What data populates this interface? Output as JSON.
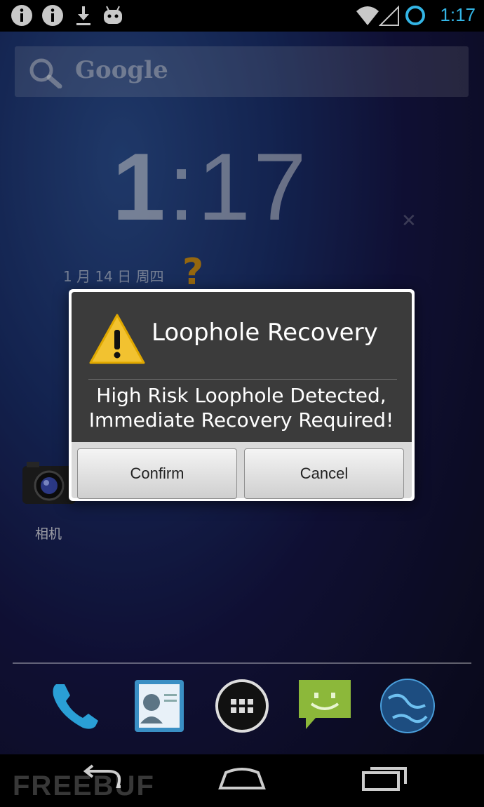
{
  "status_bar": {
    "time": "1:17",
    "icons": [
      "info-icon",
      "info-icon",
      "download-icon",
      "android-icon",
      "wifi-icon",
      "signal-icon",
      "sync-circle-icon"
    ]
  },
  "search": {
    "label": "Google",
    "icon": "search-icon"
  },
  "clock_widget": {
    "hours": "1",
    "separator": ":",
    "minutes": "17",
    "date": "1 月 14 日 周四"
  },
  "dialog": {
    "title": "Loophole Recovery",
    "message_line1": "High Risk Loophole Detected,",
    "message_line2": "Immediate Recovery Required!",
    "confirm_label": "Confirm",
    "cancel_label": "Cancel",
    "icon": "warning-icon"
  },
  "desktop": {
    "camera_label": "相机"
  },
  "dock": {
    "apps": [
      "phone-icon",
      "contacts-icon",
      "app-drawer-icon",
      "messaging-icon",
      "browser-icon"
    ]
  },
  "nav": {
    "buttons": [
      "back-icon",
      "home-icon",
      "recents-icon"
    ]
  },
  "watermark": "FREEBUF",
  "colors": {
    "accent": "#33b5e5",
    "dialog_bg": "#3b3b3b",
    "warning": "#f2c230"
  }
}
